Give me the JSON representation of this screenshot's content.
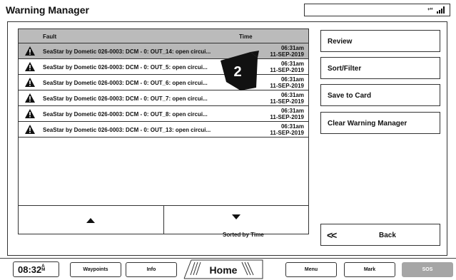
{
  "title": "Warning Manager",
  "status_icon": "gps-signal-icon",
  "table": {
    "col_fault": "Fault",
    "col_time": "Time",
    "rows": [
      {
        "fault": "SeaStar by Dometic 026-0003: DCM - 0: OUT_14: open circui...",
        "time": "06:31am",
        "date": "11-SEP-2019",
        "selected": true
      },
      {
        "fault": "SeaStar by Dometic 026-0003: DCM - 0: OUT_5: open circui...",
        "time": "06:31am",
        "date": "11-SEP-2019",
        "selected": false
      },
      {
        "fault": "SeaStar by Dometic 026-0003: DCM - 0: OUT_6: open circui...",
        "time": "06:31am",
        "date": "11-SEP-2019",
        "selected": false
      },
      {
        "fault": "SeaStar by Dometic 026-0003: DCM - 0: OUT_7: open circui...",
        "time": "06:31am",
        "date": "11-SEP-2019",
        "selected": false
      },
      {
        "fault": "SeaStar by Dometic 026-0003: DCM - 0: OUT_8: open circui...",
        "time": "06:31am",
        "date": "11-SEP-2019",
        "selected": false
      },
      {
        "fault": "SeaStar by Dometic 026-0003: DCM - 0: OUT_13: open circui...",
        "time": "06:31am",
        "date": "11-SEP-2019",
        "selected": false
      }
    ],
    "sorted_label": "Sorted by Time"
  },
  "callout_number": "2",
  "side": {
    "review": "Review",
    "sort_filter": "Sort/Filter",
    "save_to_card": "Save to Card",
    "clear_warning_manager": "Clear Warning Manager",
    "back": "Back"
  },
  "bottom": {
    "clock": "08:32",
    "clock_am": "A",
    "clock_m": "M",
    "waypoints": "Waypoints",
    "info": "Info",
    "home": "Home",
    "menu": "Menu",
    "mark": "Mark",
    "sos": "SOS"
  }
}
